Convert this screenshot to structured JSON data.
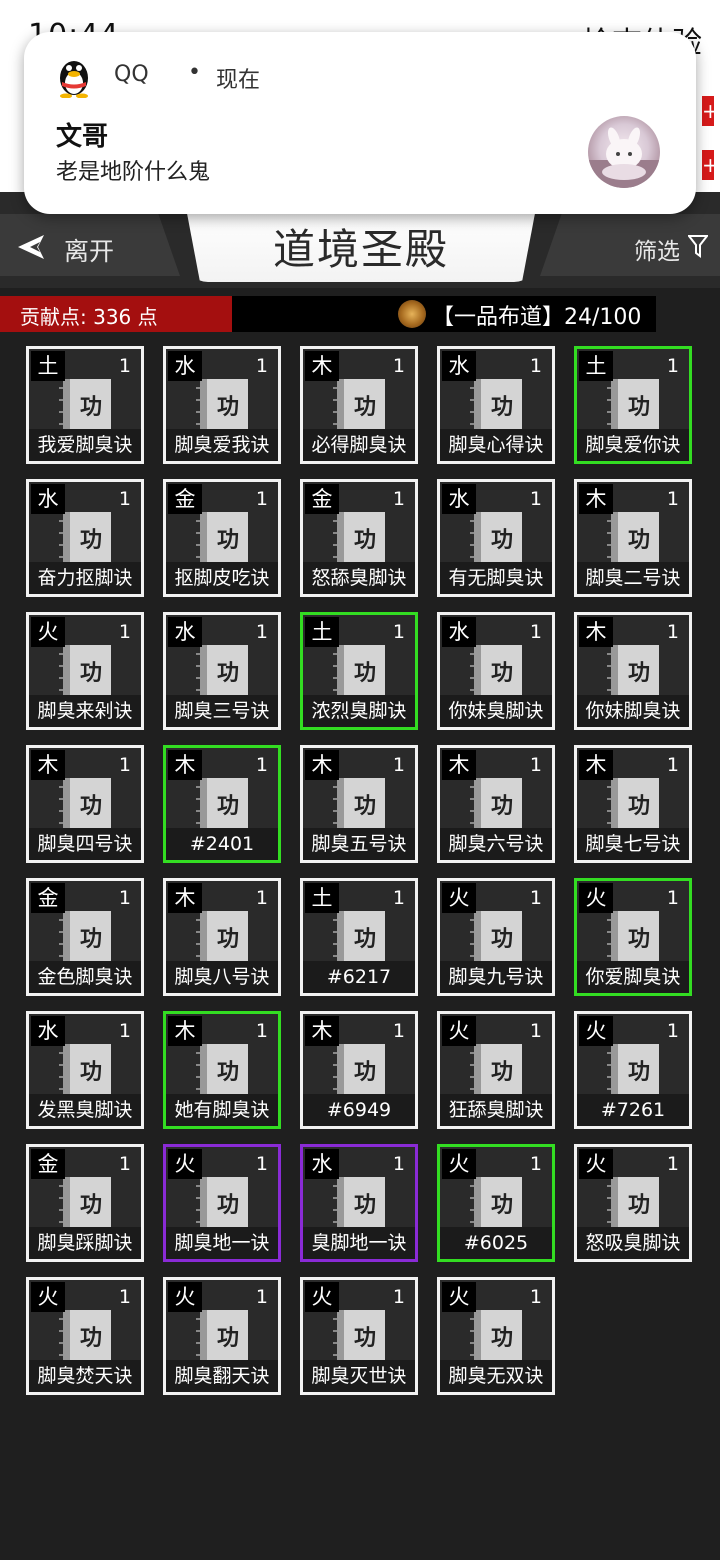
{
  "status": {
    "time": "10:44",
    "right_text": "检查体验"
  },
  "notification": {
    "app": "QQ",
    "separator": "•",
    "time": "现在",
    "title": "文哥",
    "message": "老是地阶什么鬼",
    "icon": "qq-penguin-icon",
    "avatar": "contact-avatar"
  },
  "header": {
    "leave_label": "离开",
    "title": "道境圣殿",
    "filter_label": "筛选"
  },
  "contribution": {
    "label": "贡献点: 336 点",
    "rank_label": "【一品布道】24/100"
  },
  "colors": {
    "accent_red": "#a40f0f",
    "selected_green": "#33dd22",
    "rare_purple": "#8a2bd6",
    "card_border": "#f2f2f2"
  },
  "cards": [
    {
      "element": "土",
      "count": "1",
      "glyph": "功",
      "name": "我爱脚臭诀",
      "border": "white"
    },
    {
      "element": "水",
      "count": "1",
      "glyph": "功",
      "name": "脚臭爱我诀",
      "border": "white"
    },
    {
      "element": "木",
      "count": "1",
      "glyph": "功",
      "name": "必得脚臭诀",
      "border": "white"
    },
    {
      "element": "水",
      "count": "1",
      "glyph": "功",
      "name": "脚臭心得诀",
      "border": "white"
    },
    {
      "element": "土",
      "count": "1",
      "glyph": "功",
      "name": "脚臭爱你诀",
      "border": "green"
    },
    {
      "element": "水",
      "count": "1",
      "glyph": "功",
      "name": "奋力抠脚诀",
      "border": "white"
    },
    {
      "element": "金",
      "count": "1",
      "glyph": "功",
      "name": "抠脚皮吃诀",
      "border": "white"
    },
    {
      "element": "金",
      "count": "1",
      "glyph": "功",
      "name": "怒舔臭脚诀",
      "border": "white"
    },
    {
      "element": "水",
      "count": "1",
      "glyph": "功",
      "name": "有无脚臭诀",
      "border": "white"
    },
    {
      "element": "木",
      "count": "1",
      "glyph": "功",
      "name": "脚臭二号诀",
      "border": "white"
    },
    {
      "element": "火",
      "count": "1",
      "glyph": "功",
      "name": "脚臭来剁诀",
      "border": "white"
    },
    {
      "element": "水",
      "count": "1",
      "glyph": "功",
      "name": "脚臭三号诀",
      "border": "white"
    },
    {
      "element": "土",
      "count": "1",
      "glyph": "功",
      "name": "浓烈臭脚诀",
      "border": "green"
    },
    {
      "element": "水",
      "count": "1",
      "glyph": "功",
      "name": "你妹臭脚诀",
      "border": "white"
    },
    {
      "element": "木",
      "count": "1",
      "glyph": "功",
      "name": "你妹脚臭诀",
      "border": "white"
    },
    {
      "element": "木",
      "count": "1",
      "glyph": "功",
      "name": "脚臭四号诀",
      "border": "white"
    },
    {
      "element": "木",
      "count": "1",
      "glyph": "功",
      "name": "#2401",
      "border": "green"
    },
    {
      "element": "木",
      "count": "1",
      "glyph": "功",
      "name": "脚臭五号诀",
      "border": "white"
    },
    {
      "element": "木",
      "count": "1",
      "glyph": "功",
      "name": "脚臭六号诀",
      "border": "white"
    },
    {
      "element": "木",
      "count": "1",
      "glyph": "功",
      "name": "脚臭七号诀",
      "border": "white"
    },
    {
      "element": "金",
      "count": "1",
      "glyph": "功",
      "name": "金色脚臭诀",
      "border": "white"
    },
    {
      "element": "木",
      "count": "1",
      "glyph": "功",
      "name": "脚臭八号诀",
      "border": "white"
    },
    {
      "element": "土",
      "count": "1",
      "glyph": "功",
      "name": "#6217",
      "border": "white"
    },
    {
      "element": "火",
      "count": "1",
      "glyph": "功",
      "name": "脚臭九号诀",
      "border": "white"
    },
    {
      "element": "火",
      "count": "1",
      "glyph": "功",
      "name": "你爱脚臭诀",
      "border": "green"
    },
    {
      "element": "水",
      "count": "1",
      "glyph": "功",
      "name": "发黑臭脚诀",
      "border": "white"
    },
    {
      "element": "木",
      "count": "1",
      "glyph": "功",
      "name": "她有脚臭诀",
      "border": "green"
    },
    {
      "element": "木",
      "count": "1",
      "glyph": "功",
      "name": "#6949",
      "border": "white"
    },
    {
      "element": "火",
      "count": "1",
      "glyph": "功",
      "name": "狂舔臭脚诀",
      "border": "white"
    },
    {
      "element": "火",
      "count": "1",
      "glyph": "功",
      "name": "#7261",
      "border": "white"
    },
    {
      "element": "金",
      "count": "1",
      "glyph": "功",
      "name": "脚臭踩脚诀",
      "border": "white"
    },
    {
      "element": "火",
      "count": "1",
      "glyph": "功",
      "name": "脚臭地一诀",
      "border": "purple"
    },
    {
      "element": "水",
      "count": "1",
      "glyph": "功",
      "name": "臭脚地一诀",
      "border": "purple"
    },
    {
      "element": "火",
      "count": "1",
      "glyph": "功",
      "name": "#6025",
      "border": "green"
    },
    {
      "element": "火",
      "count": "1",
      "glyph": "功",
      "name": "怒吸臭脚诀",
      "border": "white"
    },
    {
      "element": "火",
      "count": "1",
      "glyph": "功",
      "name": "脚臭焚天诀",
      "border": "white"
    },
    {
      "element": "火",
      "count": "1",
      "glyph": "功",
      "name": "脚臭翻天诀",
      "border": "white"
    },
    {
      "element": "火",
      "count": "1",
      "glyph": "功",
      "name": "脚臭灭世诀",
      "border": "white"
    },
    {
      "element": "火",
      "count": "1",
      "glyph": "功",
      "name": "脚臭无双诀",
      "border": "white"
    }
  ]
}
